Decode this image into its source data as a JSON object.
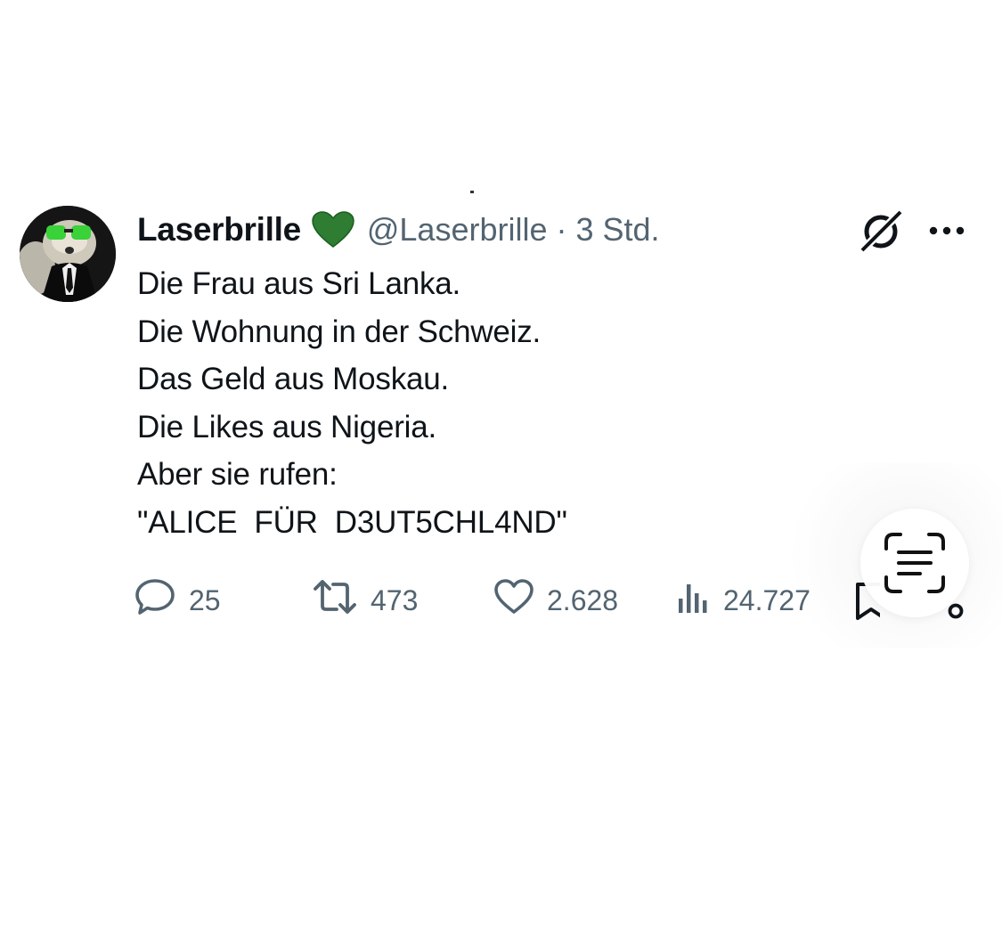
{
  "tweet": {
    "author_name": "Laserbrille",
    "verified_emoji": "green-heart",
    "handle": "@Laserbrille",
    "separator": "·",
    "time": "3 Std.",
    "lines": [
      "Die Frau aus Sri Lanka.",
      "Die Wohnung in der Schweiz.",
      "Das Geld aus Moskau.",
      "Die Likes aus Nigeria.",
      "Aber sie rufen:",
      "\"ALICE  FÜR  D3UT5CHL4ND\""
    ],
    "replies": "25",
    "reposts": "473",
    "likes": "2.628",
    "views": "24.727"
  },
  "icons": {
    "grok": "grok-icon",
    "more": "more-options-icon",
    "reply": "reply-icon",
    "repost": "repost-icon",
    "like": "like-icon",
    "views": "views-icon",
    "bookmark": "bookmark-icon",
    "share": "share-icon",
    "live_text": "live-text-scan-icon"
  },
  "colors": {
    "text": "#0f1419",
    "secondary": "#536471",
    "heart": "#2e7d32",
    "glasses": "#39d239"
  }
}
